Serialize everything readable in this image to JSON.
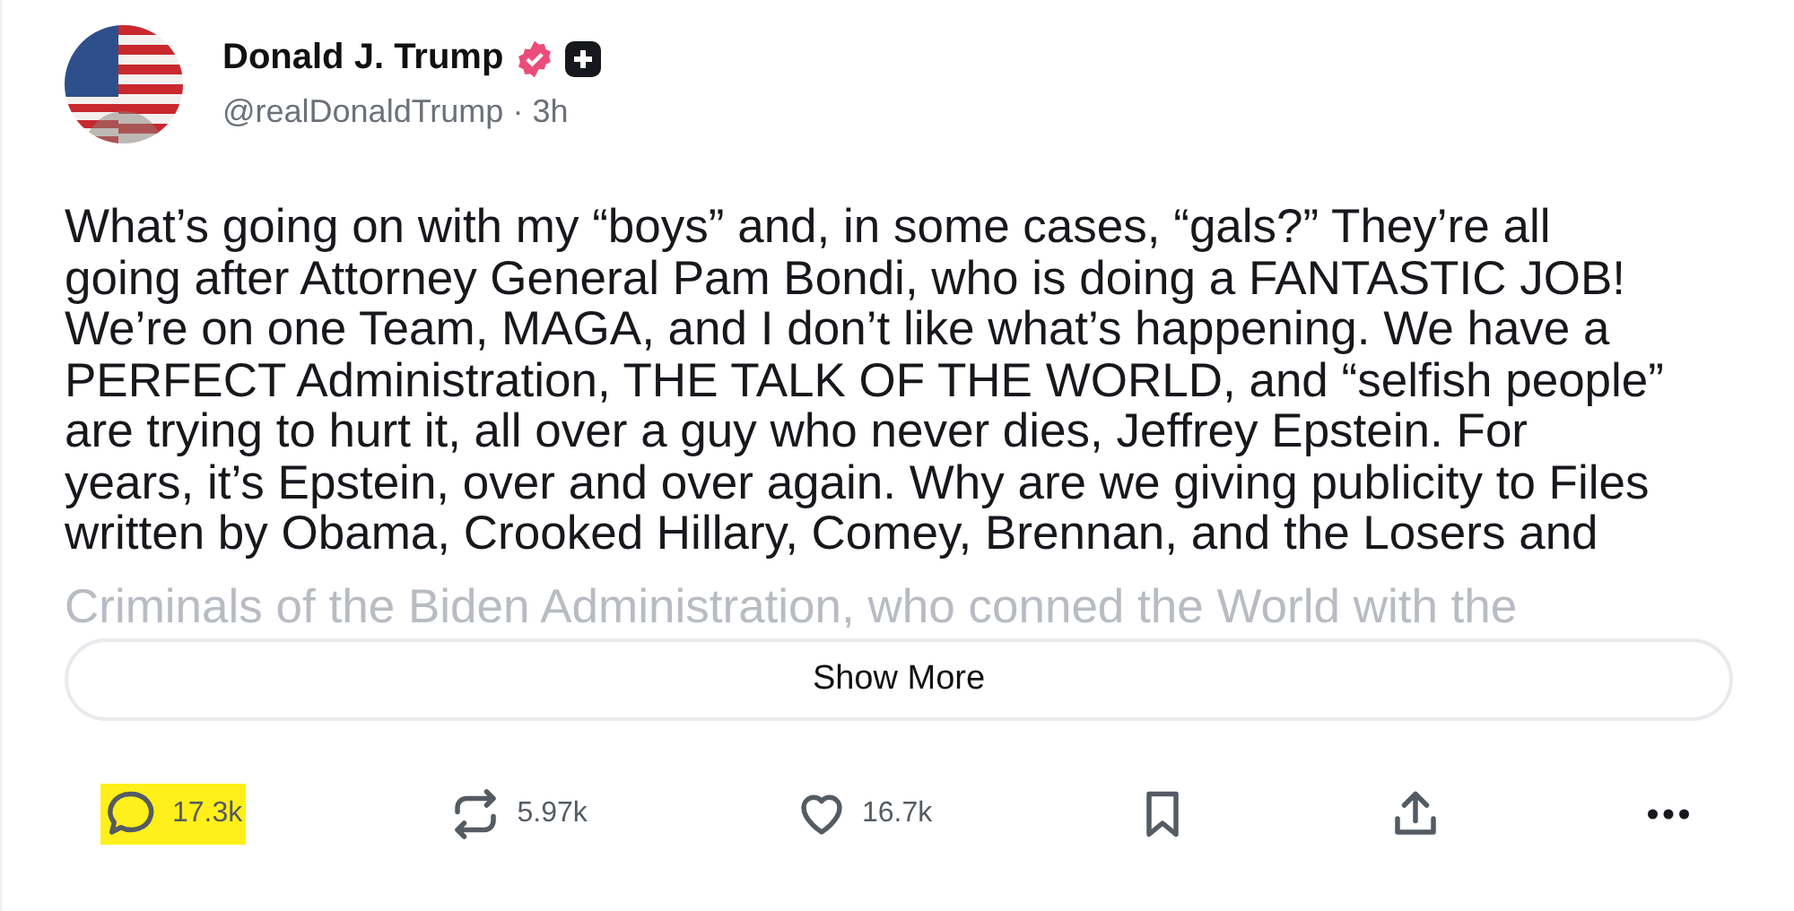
{
  "post": {
    "author": {
      "name": "Donald J. Trump",
      "verified": true,
      "handle": "@realDonaldTrump",
      "separator": "·",
      "time": "3h"
    },
    "body_lines": [
      "What’s going on with my “boys” and, in some cases, “gals?” They’re all",
      "going after Attorney General Pam Bondi, who is doing a FANTASTIC JOB!",
      "We’re on one Team, MAGA, and I don’t like what’s happening. We have a",
      "PERFECT Administration, THE TALK OF THE WORLD, and “selfish people”",
      "are trying to hurt it, all over a guy who never dies, Jeffrey Epstein. For",
      "years, it’s Epstein, over and over again. Why are we giving publicity to Files",
      "written by Obama, Crooked Hillary, Comey, Brennan, and the Losers and"
    ],
    "faded_line": "Criminals of the Biden Administration, who conned the World with the",
    "show_more": "Show More",
    "actions": [
      {
        "kind": "reply",
        "count": "17.3k",
        "highlighted": true
      },
      {
        "kind": "repost",
        "count": "5.97k",
        "highlighted": false
      },
      {
        "kind": "like",
        "count": "16.7k",
        "highlighted": false
      },
      {
        "kind": "bookmark"
      },
      {
        "kind": "share"
      },
      {
        "kind": "more"
      }
    ]
  }
}
